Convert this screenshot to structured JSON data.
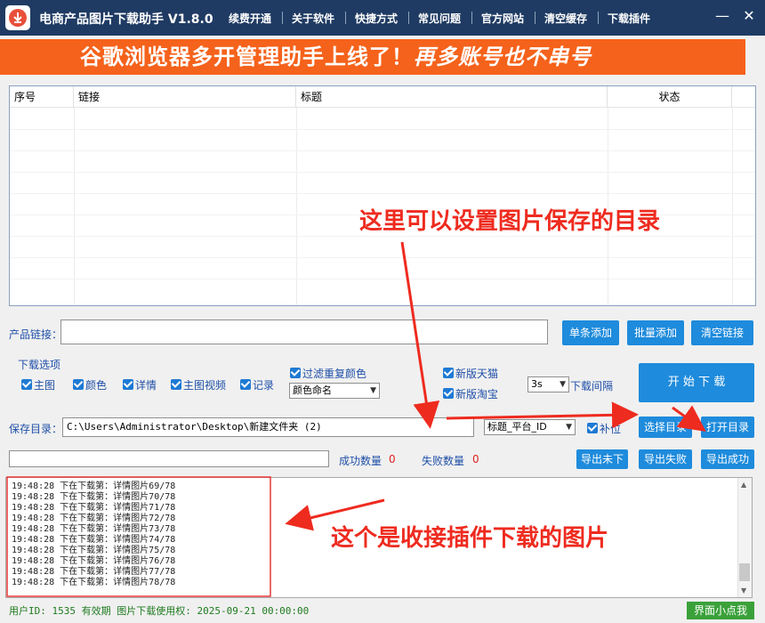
{
  "app": {
    "title": "电商产品图片下载助手 V1.8.0",
    "menu": [
      "续费开通",
      "关于软件",
      "快捷方式",
      "常见问题",
      "官方网站",
      "清空缓存",
      "下载插件"
    ]
  },
  "banner": {
    "text_main": "谷歌浏览器多开管理助手上线了！",
    "text_italic": "再多账号也不串号"
  },
  "table": {
    "columns": [
      "序号",
      "链接",
      "标题",
      "状态"
    ]
  },
  "product_link": {
    "label": "产品链接：",
    "value": "",
    "buttons": [
      "单条添加",
      "批量添加",
      "清空链接"
    ]
  },
  "download_options": {
    "group_label": "下载选项",
    "checkboxes": [
      "主图",
      "颜色",
      "详情",
      "主图视频",
      "记录"
    ],
    "filter_duplicate_colors": "过滤重复颜色",
    "color_naming": "颜色命名",
    "new_tmall": "新版天猫",
    "new_taobao": "新版淘宝",
    "interval_value": "3s",
    "interval_label": "下载间隔",
    "start_button": "开 始 下 载"
  },
  "save_dir": {
    "label": "保存目录：",
    "path": "C:\\Users\\Administrator\\Desktop\\新建文件夹 (2)",
    "naming": "标题_平台_ID",
    "pad_label": "补位",
    "choose_button": "选择目录",
    "open_button": "打开目录"
  },
  "stats": {
    "success_label": "成功数量",
    "success_count": "0",
    "fail_label": "失败数量",
    "fail_count": "0",
    "export_buttons": [
      "导出未下",
      "导出失败",
      "导出成功"
    ]
  },
  "log": [
    "19:48:28 下在下载第：详情图片69/78",
    "19:48:28 下在下载第：详情图片70/78",
    "19:48:28 下在下载第：详情图片71/78",
    "19:48:28 下在下载第：详情图片72/78",
    "19:48:28 下在下载第：详情图片73/78",
    "19:48:28 下在下载第：详情图片74/78",
    "19:48:28 下在下载第：详情图片75/78",
    "19:48:28 下在下载第：详情图片76/78",
    "19:48:28 下在下载第：详情图片77/78",
    "19:48:28 下在下载第：详情图片78/78"
  ],
  "status": {
    "text": "用户ID: 1535 有效期 图片下载使用权: 2025-09-21 00:00:00",
    "compact_button": "界面小点我"
  },
  "annotations": {
    "dir_note": "这里可以设置图片保存的目录",
    "plugin_note": "这个是收接插件下载的图片"
  },
  "colors": {
    "titlebar": "#1f3b63",
    "banner": "#f5621b",
    "button": "#1e8bdc",
    "annotation": "#ee2b1f",
    "status_green": "#3aa13a"
  }
}
